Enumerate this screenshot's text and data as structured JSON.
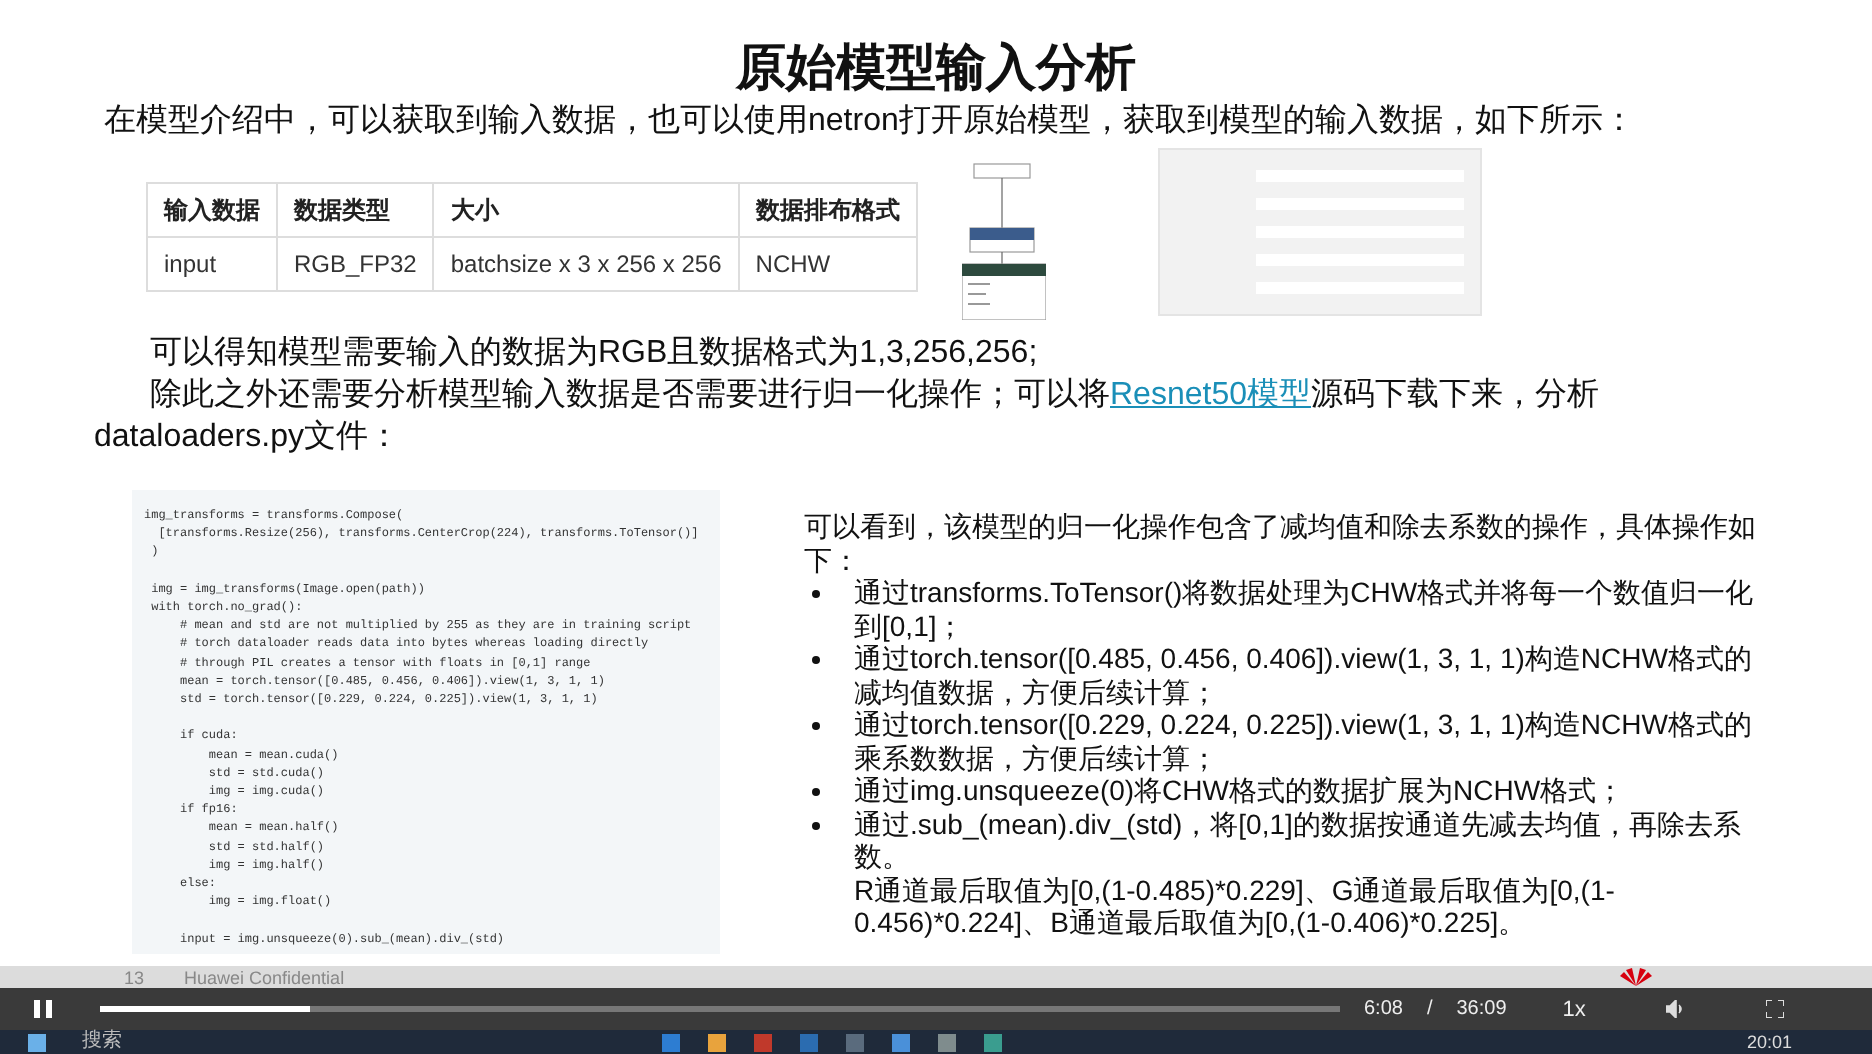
{
  "slide": {
    "title": "原始模型输入分析",
    "intro": "在模型介绍中，可以获取到输入数据，也可以使用netron打开原始模型，获取到模型的输入数据，如下所示：",
    "table": {
      "columns": [
        "输入数据",
        "数据类型",
        "大小",
        "数据排布格式"
      ],
      "rows": [
        [
          "input",
          "RGB_FP32",
          "batchsize x 3 x 256 x 256",
          "NCHW"
        ]
      ]
    },
    "paragraph_1": "可以得知模型需要输入的数据为RGB且数据格式为1,3,256,256;",
    "paragraph_2": {
      "before": "除此之外还需要分析模型输入数据是否需要进行归一化操作；可以将",
      "link": "Resnet50模型",
      "after": "源码下载下来，分析dataloaders.py文件："
    },
    "code_blocks": [
      [
        "img_transforms = transforms.Compose(",
        "  [transforms.Resize(256), transforms.CenterCrop(224), transforms.ToTensor()]",
        " )"
      ],
      [
        " img = img_transforms(Image.open(path))",
        " with torch.no_grad():",
        "     # mean and std are not multiplied by 255 as they are in training script",
        "     # torch dataloader reads data into bytes whereas loading directly",
        "     # through PIL creates a tensor with floats in [0,1] range",
        "     mean = torch.tensor([0.485, 0.456, 0.406]).view(1, 3, 1, 1)",
        "     std = torch.tensor([0.229, 0.224, 0.225]).view(1, 3, 1, 1)"
      ],
      [
        "     if cuda:",
        "         mean = mean.cuda()",
        "         std = std.cuda()",
        "         img = img.cuda()",
        "     if fp16:",
        "         mean = mean.half()",
        "         std = std.half()",
        "         img = img.half()",
        "     else:",
        "         img = img.float()"
      ],
      [
        "     input = img.unsqueeze(0).sub_(mean).div_(std)"
      ]
    ],
    "explain_intro": "可以看到，该模型的归一化操作包含了减均值和除去系数的操作，具体操作如下：",
    "bullets": [
      {
        "text": "通过transforms.ToTensor()将数据处理为CHW格式并将每一个数值归一化到[0,1]；"
      },
      {
        "text": "通过torch.tensor([0.485, 0.456, 0.406]).view(1, 3, 1, 1)构造NCHW格式的减均值数据，方便后续计算；"
      },
      {
        "text": "通过torch.tensor([0.229, 0.224, 0.225]).view(1, 3, 1, 1)构造NCHW格式的乘系数数据，方便后续计算；"
      },
      {
        "text": "通过img.unsqueeze(0)将CHW格式的数据扩展为NCHW格式；"
      },
      {
        "text": "通过.sub_(mean).div_(std)，将[0,1]的数据按通道先减去均值，再除去系数。",
        "note": "R通道最后取值为[0,(1-0.485)*0.229]、G通道最后取值为[0,(1-0.456)*0.224]、B通道最后取值为[0,(1-0.406)*0.225]。"
      }
    ],
    "footer": {
      "page": "13",
      "label": "Huawei Confidential"
    }
  },
  "player": {
    "playing": true,
    "level": 0.17,
    "current": "6:08",
    "separator": "/",
    "total": "36:09",
    "speed": "1x"
  },
  "taskbar": {
    "search": "搜索",
    "clock": "20:01"
  }
}
